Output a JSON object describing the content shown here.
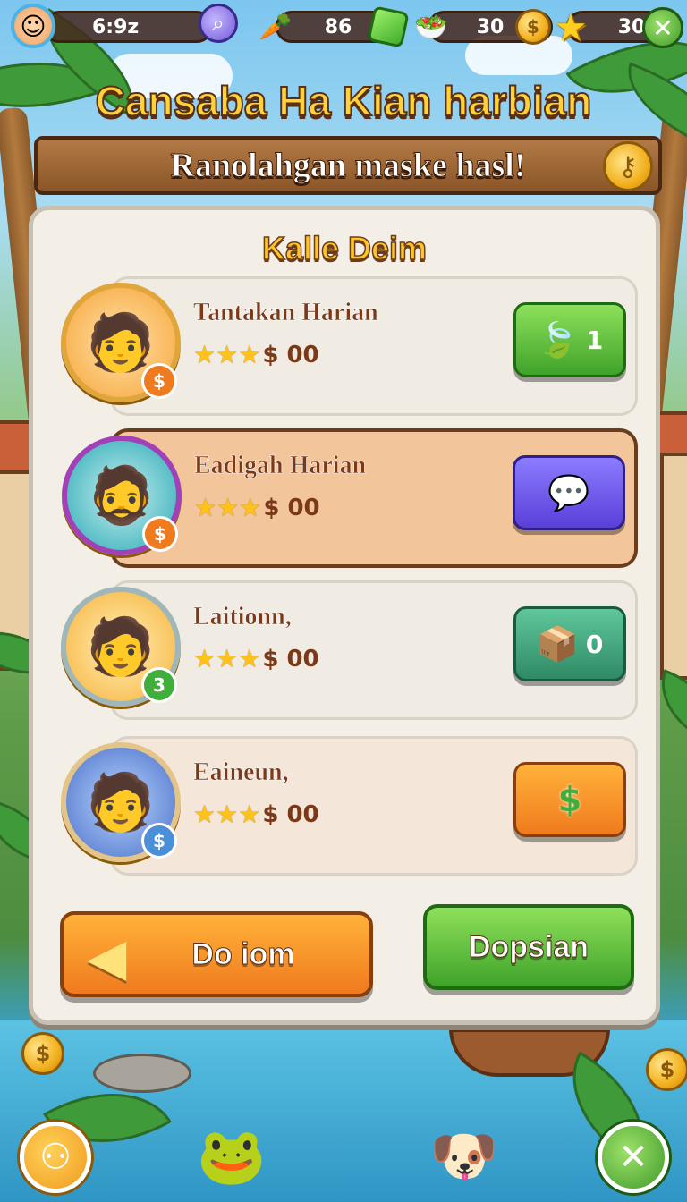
{
  "topbar": {
    "timer": "6:9z",
    "gems": "86",
    "food": "30",
    "stars": "30",
    "icons": {
      "avatar": "player-avatar",
      "search": "magnifier-icon",
      "veggie": "vegetable-icon",
      "gem": "green-gem-icon",
      "food": "food-bowl-icon",
      "coin": "gold-coin-icon",
      "star": "star-icon",
      "close": "close-icon"
    }
  },
  "title": "Cansaba Ha Kian harbian",
  "banner": "Ranolahgan maske hasl!",
  "panel": {
    "title": "Kalle Deim",
    "rows": [
      {
        "name": "Tantakan Harian",
        "score": "$ 00",
        "button_value": "1",
        "button_icon": "leaf-icon",
        "badge": "$"
      },
      {
        "name": "Eadigah Harian",
        "score": "$ 00",
        "button_value": "",
        "button_icon": "chat-bubble-icon",
        "badge": "$"
      },
      {
        "name": "Laitionn,",
        "score": "$ 00",
        "button_value": "0",
        "button_icon": "crate-icon",
        "badge": "3"
      },
      {
        "name": "Eaineun,",
        "score": "$ 00",
        "button_value": "",
        "button_icon": "dollar-splash-icon",
        "badge": "$"
      }
    ],
    "primary_button": "Do iom",
    "secondary_button": "Dopsian"
  },
  "colors": {
    "title_gold": "#ffd23a",
    "panel_bg": "#f4efe6",
    "highlight_row": "#f2c59a",
    "green_button": "#3fa32a",
    "orange_button": "#f07a1e"
  }
}
